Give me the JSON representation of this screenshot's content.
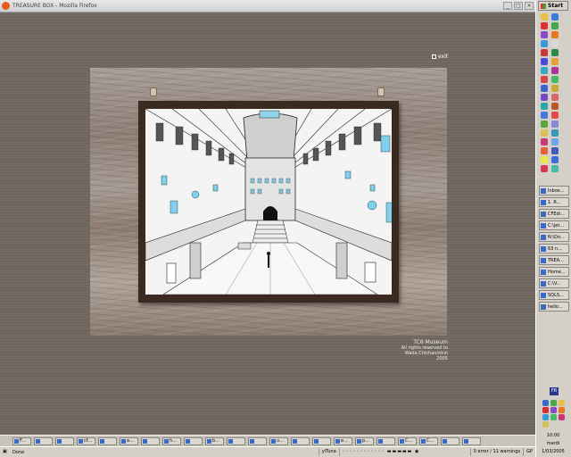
{
  "window": {
    "title": "TREASURE BOX - Mozilla Firefox",
    "buttons": [
      "_",
      "□",
      "×"
    ]
  },
  "page": {
    "exit_label": "exit",
    "credits": {
      "museum": "TC6 Museum",
      "rights": "All rights reserved to",
      "author": "Wada Chichan/nhin",
      "year": "2005"
    }
  },
  "statusbar": {
    "status": "Done",
    "search_engine": "yiTuna",
    "errors": "0 error / 11 warnings",
    "lang": "GP"
  },
  "taskbar_bottom": {
    "items": [
      "F...",
      "",
      "",
      "cf...",
      "",
      "a...",
      "",
      "h...",
      "",
      "b...",
      "",
      "",
      "u...",
      "",
      "",
      "e...",
      "p...",
      "",
      "C...",
      "C...",
      "",
      ""
    ]
  },
  "start": {
    "label": "Start"
  },
  "right_tasks": [
    {
      "label": "Inbox..."
    },
    {
      "label": "1. R..."
    },
    {
      "label": "CFEdi..."
    },
    {
      "label": "C:\\jet..."
    },
    {
      "label": "N:\\Do..."
    },
    {
      "label": "63 n..."
    },
    {
      "label": "TREA..."
    },
    {
      "label": "Home..."
    },
    {
      "label": "C:\\V..."
    },
    {
      "label": "SQLS..."
    },
    {
      "label": "hello..."
    }
  ],
  "tray": {
    "time": "10:00",
    "day": "mardi",
    "date": "1/03/2005",
    "lang": "FR"
  },
  "quicklaunch_colors": [
    "#e8c048",
    "#3a7ad8",
    "#d83030",
    "#48a848",
    "#8a48c8",
    "#e87820",
    "#3a9ad8",
    "#d8d8d8",
    "#c83838",
    "#2a8a48",
    "#4a4ad8",
    "#e8a030",
    "#38a8c8",
    "#a83898",
    "#d84848",
    "#48b868",
    "#3868c8",
    "#c8a838",
    "#7848c8",
    "#d86868",
    "#2aa8a8",
    "#b85828",
    "#4878d8",
    "#e84848",
    "#58a838",
    "#8888d8",
    "#d8c058",
    "#3898b8",
    "#c83878",
    "#68a8e8",
    "#e86038",
    "#4858b8",
    "#e8e848",
    "#3870d8",
    "#d83858",
    "#48b8a8"
  ],
  "tray_icon_colors": [
    "#3a6ac8",
    "#48a848",
    "#e8c048",
    "#d83030",
    "#8a48c8",
    "#e87820",
    "#3a9ad8",
    "#48b868",
    "#c83878",
    "#d8c058"
  ]
}
